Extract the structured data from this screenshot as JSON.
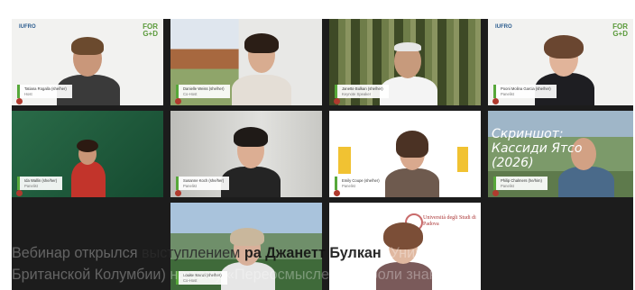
{
  "tiles": [
    {
      "id": "t1",
      "name": "Tatiana Rogalla (she/her)",
      "role": "Host",
      "logo_left": "IUFRO",
      "logo_right": "FOR\nG+D",
      "accent": "#57a83a"
    },
    {
      "id": "t2",
      "name": "Danielle Weiss (she/her)",
      "role": "Co-Host",
      "accent": "#57a83a"
    },
    {
      "id": "t3",
      "name": "Janette Bulkan (she/her)",
      "role": "Keynote Speaker",
      "accent": "#57a83a"
    },
    {
      "id": "t4",
      "name": "Pooni Molina Garcia (she/her)",
      "role": "Panelist",
      "logo_left": "IUFRO",
      "logo_right": "FOR\nG+D",
      "accent": "#57a83a"
    },
    {
      "id": "t5",
      "name": "Ida Wallin (she/her)",
      "role": "Panelist",
      "accent": "#57a83a"
    },
    {
      "id": "t6",
      "name": "Susanne Koch (she/her)",
      "role": "Panelist",
      "accent": "#57a83a"
    },
    {
      "id": "t7",
      "name": "Emily Coupe (she/her)",
      "role": "Panelist",
      "accent": "#57a83a"
    },
    {
      "id": "t8",
      "name": "Philip Chalmers (he/him)",
      "role": "Panelist",
      "accent": "#57a83a"
    },
    {
      "id": "t9",
      "name": "Louise Menzi (she/her)",
      "role": "Co-Host",
      "accent": "#57a83a"
    },
    {
      "id": "t10",
      "name": "",
      "role": "",
      "logo_text": "Università degli Studi di Padova",
      "accent": "#b03a2e"
    }
  ],
  "watermark": "Скриншот: Кассиди Ятсо (2026)",
  "caption": {
    "line1_part1": "Вебинар открылся ",
    "line1_part2": "выступлением ",
    "line1_bold": "ра Джанетт Булкан",
    "line1_part3": " (Университет",
    "line2": "Британской Колумбии) на тему «Переосмысления о роли знаний в"
  }
}
